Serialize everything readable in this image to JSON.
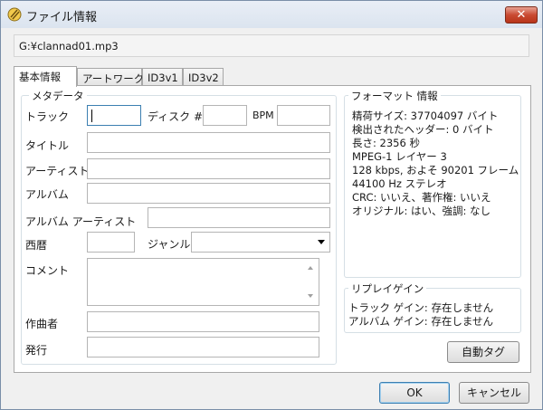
{
  "window": {
    "title": "ファイル情報",
    "close_label": "✕"
  },
  "file_path": "G:¥clannad01.mp3",
  "tabs": [
    {
      "label": "基本情報",
      "active": true
    },
    {
      "label": "アートワーク",
      "active": false
    },
    {
      "label": "ID3v1",
      "active": false
    },
    {
      "label": "ID3v2",
      "active": false
    }
  ],
  "metadata": {
    "legend": "メタデータ",
    "track_label": "トラック",
    "track_value": "",
    "disc_label": "ディスク #",
    "disc_value": "",
    "bpm_label": "BPM",
    "bpm_value": "",
    "title_label": "タイトル",
    "title_value": "",
    "artist_label": "アーティスト",
    "artist_value": "",
    "album_label": "アルバム",
    "album_value": "",
    "album_artist_label": "アルバム アーティスト",
    "album_artist_value": "",
    "year_label": "西暦",
    "year_value": "",
    "genre_label": "ジャンル",
    "genre_value": "",
    "comment_label": "コメント",
    "comment_value": "",
    "composer_label": "作曲者",
    "composer_value": "",
    "publisher_label": "発行",
    "publisher_value": ""
  },
  "format_info": {
    "legend": "フォーマット 情報",
    "lines": [
      "精荷サイズ: 37704097 バイト",
      "検出されたヘッダー: 0 バイト",
      "長さ: 2356 秒",
      "MPEG-1 レイヤー 3",
      "128 kbps, およそ 90201 フレーム",
      "44100 Hz ステレオ",
      "CRC: いいえ、著作権: いいえ",
      "オリジナル: はい、強調: なし"
    ]
  },
  "replay_gain": {
    "legend": "リプレイゲイン",
    "track_gain": "トラック ゲイン: 存在しません",
    "album_gain": "アルバム ゲイン: 存在しません"
  },
  "buttons": {
    "auto_tag": "自動タグ",
    "ok": "OK",
    "cancel": "キャンセル"
  },
  "colors": {
    "accent": "#3c7fb1",
    "close_button": "#c94a32"
  }
}
